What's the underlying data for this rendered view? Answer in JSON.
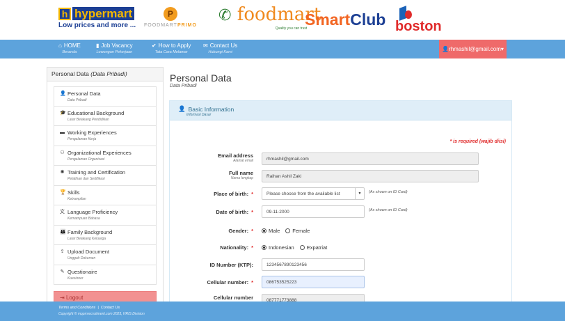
{
  "logos": {
    "hypermart": {
      "icon": "h",
      "name": "hypermart",
      "tagline": "Low prices and more ..."
    },
    "foodmart_primo": {
      "icon": "P",
      "text_a": "FOODMART",
      "text_b": "PRIMO"
    },
    "foodmart": {
      "name": "foodmart",
      "tagline": "Quality you can trust"
    },
    "smartclub": {
      "part1": "Smart",
      "part2": "Club"
    },
    "boston": {
      "name": "boston"
    }
  },
  "nav": {
    "home": {
      "label": "HOME",
      "sub": "Beranda",
      "icon": "home-icon"
    },
    "job": {
      "label": "Job Vacancy",
      "sub": "Lowongan Pekerjaan",
      "icon": "bookmark-icon"
    },
    "howto": {
      "label": "How to Apply",
      "sub": "Tata Cara Melamar",
      "icon": "check-icon"
    },
    "contact": {
      "label": "Contact Us",
      "sub": "Hubungi Kami",
      "icon": "envelope-icon"
    },
    "user": {
      "label": "rhmashil@gmail.com",
      "icon": "user-icon"
    }
  },
  "sidebar": {
    "title": "Personal Data",
    "title_sub": "(Data Pribadi)",
    "items": [
      {
        "label": "Personal Data",
        "sub": "Data Pribadi",
        "glyph": "👤"
      },
      {
        "label": "Educational Background",
        "sub": "Latar Belakang Pendidikan",
        "glyph": "🎓"
      },
      {
        "label": "Working Experiences",
        "sub": "Pengalaman Kerja",
        "glyph": "▬"
      },
      {
        "label": "Organizational Experiences",
        "sub": "Pengalaman Organisasi",
        "glyph": "⚇"
      },
      {
        "label": "Training and Certification",
        "sub": "Pelatihan dan Sertifikasi",
        "glyph": "✺"
      },
      {
        "label": "Skills",
        "sub": "Ketrampilan",
        "glyph": "🏆"
      },
      {
        "label": "Language Proficiency",
        "sub": "Kemampuan Bahasa",
        "glyph": "文"
      },
      {
        "label": "Family Background",
        "sub": "Latar Belakang Keluarga",
        "glyph": "👪"
      },
      {
        "label": "Upload Document",
        "sub": "Unggah Dokumen",
        "glyph": "⇪"
      },
      {
        "label": "Questionaire",
        "sub": "Kuesioner",
        "glyph": "✎"
      }
    ],
    "logout": "Logout"
  },
  "main": {
    "title": "Personal Data",
    "subtitle": "Data Pribadi",
    "card_title": "Basic Information",
    "card_sub": "Informasi Dasar",
    "required_note": "* is required (wajib diisi)",
    "fields": {
      "email": {
        "label": "Email address",
        "sub": "Alamat email",
        "value": "rhmashil@gmail.com"
      },
      "fullname": {
        "label": "Full name",
        "sub": "Nama lengkap",
        "value": "Raihan Ashil Zaki"
      },
      "pob": {
        "label": "Place of birth:",
        "placeholder": "Please choose from the available list",
        "note": "(As shown on ID Card)"
      },
      "dob": {
        "label": "Date of birth:",
        "value": "09-11-2000",
        "note": "(As shown on ID Card)"
      },
      "gender": {
        "label": "Gender:",
        "options": [
          "Male",
          "Female"
        ],
        "selected": "Male"
      },
      "nationality": {
        "label": "Nationality:",
        "options": [
          "Indonesian",
          "Expatriat"
        ],
        "selected": "Indonesian"
      },
      "idnum": {
        "label": "ID Number (KTP):",
        "value": "1234567890123456"
      },
      "cell": {
        "label": "Cellular number:",
        "value": "086753525223"
      },
      "cell2": {
        "label": "Cellular number",
        "value": "087771773888"
      }
    },
    "required_mark": "*"
  },
  "footer": {
    "terms": "Terms and Conditions",
    "sep": "|",
    "contact": "Contact Us",
    "copyright": "Copyright © mppmrecruitment.com 2023, HRIS Division"
  }
}
